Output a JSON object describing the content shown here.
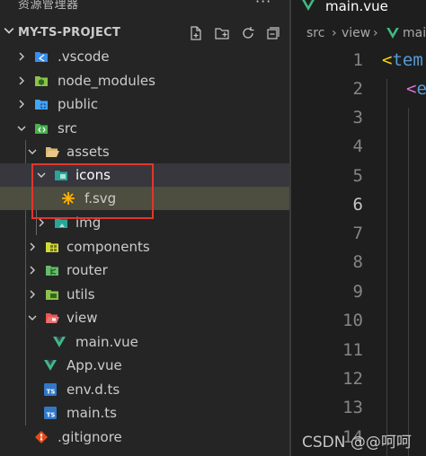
{
  "explorer": {
    "title": "资源管理器",
    "more_label": "···",
    "project": {
      "name": "MY-TS-PROJECT"
    },
    "header_actions": [
      "new-file-icon",
      "new-folder-icon",
      "refresh-icon",
      "collapse-all-icon"
    ],
    "tree": [
      {
        "label": ".vscode",
        "icon": "vscode-folder-icon",
        "expanded": false
      },
      {
        "label": "node_modules",
        "icon": "node-folder-icon",
        "expanded": false
      },
      {
        "label": "public",
        "icon": "public-folder-icon",
        "expanded": false
      },
      {
        "label": "src",
        "icon": "src-folder-icon",
        "expanded": true
      },
      {
        "label": "assets",
        "icon": "folder-open-icon",
        "expanded": true
      },
      {
        "label": "icons",
        "icon": "icons-folder-icon",
        "expanded": true,
        "selected": true
      },
      {
        "label": "f.svg",
        "icon": "svg-file-icon",
        "active": true
      },
      {
        "label": "img",
        "icon": "image-folder-icon",
        "expanded": false
      },
      {
        "label": "components",
        "icon": "components-folder-icon",
        "expanded": false
      },
      {
        "label": "router",
        "icon": "router-folder-icon",
        "expanded": false
      },
      {
        "label": "utils",
        "icon": "utils-folder-icon",
        "expanded": false
      },
      {
        "label": "view",
        "icon": "view-folder-icon",
        "expanded": true
      },
      {
        "label": "main.vue",
        "icon": "vue-file-icon"
      },
      {
        "label": "App.vue",
        "icon": "vue-file-icon"
      },
      {
        "label": "env.d.ts",
        "icon": "ts-file-icon"
      },
      {
        "label": "main.ts",
        "icon": "ts-file-icon"
      },
      {
        "label": ".gitignore",
        "icon": "git-file-icon"
      }
    ]
  },
  "editor": {
    "tab_label": "main.vue",
    "breadcrumbs": [
      "src",
      "view",
      "mai"
    ],
    "current_line": 6,
    "line_numbers": [
      "1",
      "2",
      "3",
      "4",
      "5",
      "6",
      "7",
      "8",
      "9",
      "10",
      "11",
      "12",
      "13",
      "14"
    ],
    "code_lines": [
      {
        "line": 1,
        "bracket": "<",
        "tag": "tem"
      },
      {
        "line": 2,
        "bracket": "<",
        "tag": "e"
      }
    ]
  },
  "watermark": "CSDN @@呵呵",
  "colors": {
    "sidebar_bg": "#252526",
    "editor_bg": "#1e1e1e",
    "selection_bg": "#37373d",
    "active_bg": "#4d4d40",
    "highlight_border": "#e0362c",
    "vue_green": "#41b883",
    "ts_blue": "#3178c6",
    "tag_blue": "#569cd6",
    "bracket_yellow": "#ffd700",
    "bracket_purple": "#da70d6"
  }
}
